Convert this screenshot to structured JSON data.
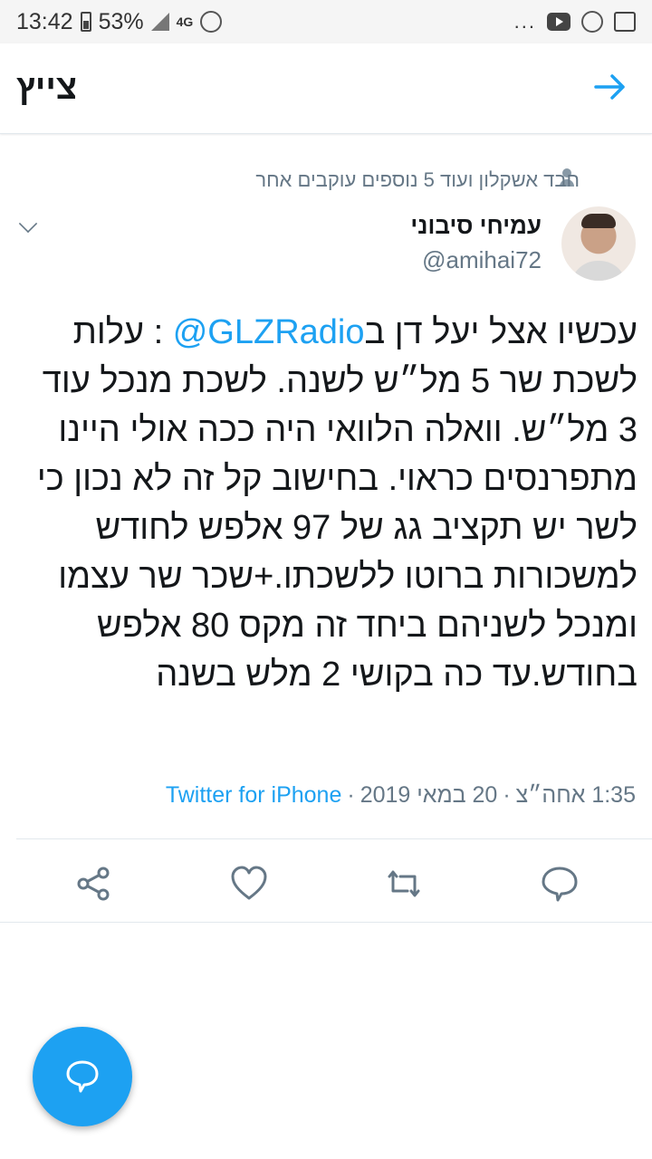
{
  "status_bar": {
    "time": "13:42",
    "battery": "53%",
    "network": "4G",
    "more": "..."
  },
  "header": {
    "title": "צייץ"
  },
  "social_context": "חבד אשקלון ועוד 5 נוספים עוקבים אחר",
  "author": {
    "name": "עמיחי סיבוני",
    "handle": "@amihai72"
  },
  "tweet": {
    "before_mention": "עכשיו אצל יעל דן ב",
    "mention": "@GLZRadio",
    "after_mention": " : עלות לשכת שר 5 מל״ש לשנה. לשכת מנכל עוד 3 מל״ש. וואלה הלוואי היה ככה אולי היינו מתפרנסים כראוי. בחישוב קל זה לא נכון כי לשר יש תקציב גג של 97 אלפש לחודש למשכורות ברוטו ללשכתו.+שכר שר עצמו ומנכל לשניהם ביחד זה מקס 80 אלפש בחודש.עד כה בקושי 2 מלש בשנה"
  },
  "meta": {
    "time": "1:35 אחה״צ",
    "date": "20 במאי 2019",
    "source": "Twitter for iPhone",
    "sep1": "·",
    "sep2": "·"
  },
  "actions": [
    "share-icon",
    "like-icon",
    "retweet-icon",
    "reply-icon"
  ],
  "colors": {
    "accent": "#1da1f2",
    "secondary_text": "#657786",
    "divider": "#e1e8ed"
  }
}
